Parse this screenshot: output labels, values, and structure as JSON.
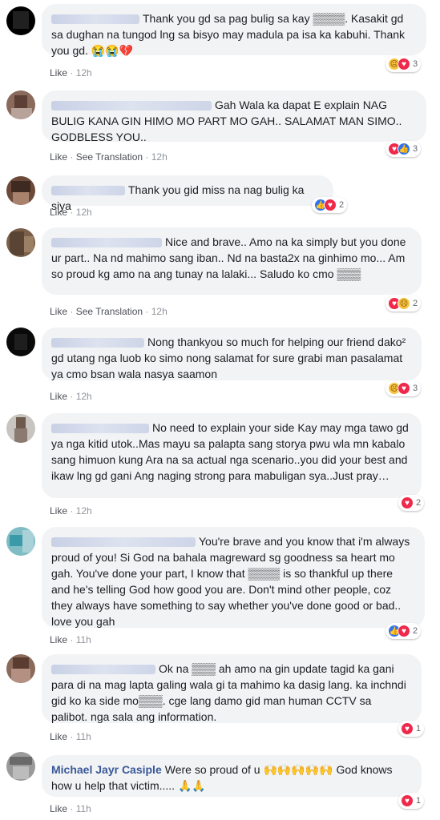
{
  "comments": [
    {
      "name": "",
      "text": "Thank you gd sa pag bulig sa kay ▒▒▒▒. Kasakit gd sa dughan na tungod lng sa bisyo may madula pa isa ka kabuhi. Thank you gd. 😭😭💔",
      "like": "Like",
      "translate": "",
      "time": "12h",
      "reactions": [
        "sad-icon",
        "love-icon"
      ],
      "count": "3"
    },
    {
      "name": "",
      "text": "Gah Wala ka dapat E explain NAG BULIG KANA GIN HIMO MO PART MO GAH.. SALAMAT MAN SIMO.. GODBLESS YOU..",
      "like": "Like",
      "translate": "See Translation",
      "time": "12h",
      "reactions": [
        "love-icon",
        "like-icon"
      ],
      "count": "3"
    },
    {
      "name": "",
      "text": "Thank you gid miss na nag bulig ka siya",
      "like": "Like",
      "translate": "",
      "time": "12h",
      "reactions": [
        "like-icon",
        "love-icon"
      ],
      "count": "2"
    },
    {
      "name": "",
      "text": "Nice and brave.. Amo na ka simply but you done ur part.. Na nd mahimo sang iban.. Nd na basta2x na ginhimo mo... Am so proud kg amo na ang tunay na lalaki... Saludo ko cmo ▒▒▒",
      "like": "Like",
      "translate": "See Translation",
      "time": "12h",
      "reactions": [
        "love-icon",
        "sad-icon"
      ],
      "count": "2"
    },
    {
      "name": "",
      "text": "Nong thankyou so much for helping our friend dako² gd utang nga luob ko simo nong salamat for sure grabi man pasalamat ya cmo bsan wala nasya saamon",
      "like": "Like",
      "translate": "",
      "time": "12h",
      "reactions": [
        "sad-icon",
        "love-icon"
      ],
      "count": "3"
    },
    {
      "name": "",
      "text": "No need to explain your side Kay may mga tawo gd ya nga kitid utok..Mas mayu sa palapta sang storya pwu wla mn kabalo sang himuon kung Ara na sa actual nga scenario..you did your best and ikaw lng gd gani Ang naging strong para mabuligan sya..Just pray…",
      "like": "Like",
      "translate": "",
      "time": "12h",
      "reactions": [
        "love-icon"
      ],
      "count": "2"
    },
    {
      "name": "",
      "text": "You're brave and you know that i'm always proud of you! Si God na bahala magreward sg goodness sa heart mo gah. You've done your part, I know that ▒▒▒▒ is so thankful up there and he's telling God how good you are. Don't mind other people, coz they always have something to say whether you've done good or bad.. love you gah",
      "like": "Like",
      "translate": "",
      "time": "11h",
      "reactions": [
        "like-icon",
        "love-icon"
      ],
      "count": "2"
    },
    {
      "name": "",
      "text": "Ok na ▒▒▒ ah amo na gin update tagid ka gani para di na mag lapta galing wala gi ta mahimo ka dasig lang. ka inchndi gid ko ka side mo▒▒▒. cge lang damo gid man human CCTV sa palibot. nga sala ang information.",
      "like": "Like",
      "translate": "",
      "time": "11h",
      "reactions": [
        "love-icon"
      ],
      "count": "1"
    },
    {
      "name": "Michael Jayr Casiple",
      "text": "Were so proud of u 🙌🙌🙌🙌🙌 God knows how u help that victim..... 🙏🙏",
      "like": "Like",
      "translate": "",
      "time": "11h",
      "reactions": [
        "love-icon"
      ],
      "count": "1"
    }
  ]
}
